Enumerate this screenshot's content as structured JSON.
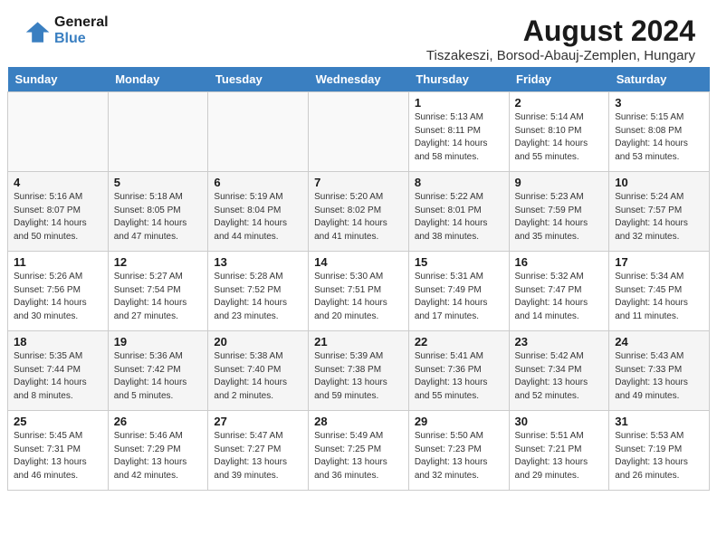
{
  "header": {
    "logo_line1": "General",
    "logo_line2": "Blue",
    "main_title": "August 2024",
    "subtitle": "Tiszakeszi, Borsod-Abauj-Zemplen, Hungary"
  },
  "days_of_week": [
    "Sunday",
    "Monday",
    "Tuesday",
    "Wednesday",
    "Thursday",
    "Friday",
    "Saturday"
  ],
  "weeks": [
    {
      "days": [
        {
          "num": "",
          "info": "",
          "empty": true
        },
        {
          "num": "",
          "info": "",
          "empty": true
        },
        {
          "num": "",
          "info": "",
          "empty": true
        },
        {
          "num": "",
          "info": "",
          "empty": true
        },
        {
          "num": "1",
          "info": "Sunrise: 5:13 AM\nSunset: 8:11 PM\nDaylight: 14 hours\nand 58 minutes.",
          "empty": false
        },
        {
          "num": "2",
          "info": "Sunrise: 5:14 AM\nSunset: 8:10 PM\nDaylight: 14 hours\nand 55 minutes.",
          "empty": false
        },
        {
          "num": "3",
          "info": "Sunrise: 5:15 AM\nSunset: 8:08 PM\nDaylight: 14 hours\nand 53 minutes.",
          "empty": false
        }
      ]
    },
    {
      "days": [
        {
          "num": "4",
          "info": "Sunrise: 5:16 AM\nSunset: 8:07 PM\nDaylight: 14 hours\nand 50 minutes.",
          "empty": false
        },
        {
          "num": "5",
          "info": "Sunrise: 5:18 AM\nSunset: 8:05 PM\nDaylight: 14 hours\nand 47 minutes.",
          "empty": false
        },
        {
          "num": "6",
          "info": "Sunrise: 5:19 AM\nSunset: 8:04 PM\nDaylight: 14 hours\nand 44 minutes.",
          "empty": false
        },
        {
          "num": "7",
          "info": "Sunrise: 5:20 AM\nSunset: 8:02 PM\nDaylight: 14 hours\nand 41 minutes.",
          "empty": false
        },
        {
          "num": "8",
          "info": "Sunrise: 5:22 AM\nSunset: 8:01 PM\nDaylight: 14 hours\nand 38 minutes.",
          "empty": false
        },
        {
          "num": "9",
          "info": "Sunrise: 5:23 AM\nSunset: 7:59 PM\nDaylight: 14 hours\nand 35 minutes.",
          "empty": false
        },
        {
          "num": "10",
          "info": "Sunrise: 5:24 AM\nSunset: 7:57 PM\nDaylight: 14 hours\nand 32 minutes.",
          "empty": false
        }
      ]
    },
    {
      "days": [
        {
          "num": "11",
          "info": "Sunrise: 5:26 AM\nSunset: 7:56 PM\nDaylight: 14 hours\nand 30 minutes.",
          "empty": false
        },
        {
          "num": "12",
          "info": "Sunrise: 5:27 AM\nSunset: 7:54 PM\nDaylight: 14 hours\nand 27 minutes.",
          "empty": false
        },
        {
          "num": "13",
          "info": "Sunrise: 5:28 AM\nSunset: 7:52 PM\nDaylight: 14 hours\nand 23 minutes.",
          "empty": false
        },
        {
          "num": "14",
          "info": "Sunrise: 5:30 AM\nSunset: 7:51 PM\nDaylight: 14 hours\nand 20 minutes.",
          "empty": false
        },
        {
          "num": "15",
          "info": "Sunrise: 5:31 AM\nSunset: 7:49 PM\nDaylight: 14 hours\nand 17 minutes.",
          "empty": false
        },
        {
          "num": "16",
          "info": "Sunrise: 5:32 AM\nSunset: 7:47 PM\nDaylight: 14 hours\nand 14 minutes.",
          "empty": false
        },
        {
          "num": "17",
          "info": "Sunrise: 5:34 AM\nSunset: 7:45 PM\nDaylight: 14 hours\nand 11 minutes.",
          "empty": false
        }
      ]
    },
    {
      "days": [
        {
          "num": "18",
          "info": "Sunrise: 5:35 AM\nSunset: 7:44 PM\nDaylight: 14 hours\nand 8 minutes.",
          "empty": false
        },
        {
          "num": "19",
          "info": "Sunrise: 5:36 AM\nSunset: 7:42 PM\nDaylight: 14 hours\nand 5 minutes.",
          "empty": false
        },
        {
          "num": "20",
          "info": "Sunrise: 5:38 AM\nSunset: 7:40 PM\nDaylight: 14 hours\nand 2 minutes.",
          "empty": false
        },
        {
          "num": "21",
          "info": "Sunrise: 5:39 AM\nSunset: 7:38 PM\nDaylight: 13 hours\nand 59 minutes.",
          "empty": false
        },
        {
          "num": "22",
          "info": "Sunrise: 5:41 AM\nSunset: 7:36 PM\nDaylight: 13 hours\nand 55 minutes.",
          "empty": false
        },
        {
          "num": "23",
          "info": "Sunrise: 5:42 AM\nSunset: 7:34 PM\nDaylight: 13 hours\nand 52 minutes.",
          "empty": false
        },
        {
          "num": "24",
          "info": "Sunrise: 5:43 AM\nSunset: 7:33 PM\nDaylight: 13 hours\nand 49 minutes.",
          "empty": false
        }
      ]
    },
    {
      "days": [
        {
          "num": "25",
          "info": "Sunrise: 5:45 AM\nSunset: 7:31 PM\nDaylight: 13 hours\nand 46 minutes.",
          "empty": false
        },
        {
          "num": "26",
          "info": "Sunrise: 5:46 AM\nSunset: 7:29 PM\nDaylight: 13 hours\nand 42 minutes.",
          "empty": false
        },
        {
          "num": "27",
          "info": "Sunrise: 5:47 AM\nSunset: 7:27 PM\nDaylight: 13 hours\nand 39 minutes.",
          "empty": false
        },
        {
          "num": "28",
          "info": "Sunrise: 5:49 AM\nSunset: 7:25 PM\nDaylight: 13 hours\nand 36 minutes.",
          "empty": false
        },
        {
          "num": "29",
          "info": "Sunrise: 5:50 AM\nSunset: 7:23 PM\nDaylight: 13 hours\nand 32 minutes.",
          "empty": false
        },
        {
          "num": "30",
          "info": "Sunrise: 5:51 AM\nSunset: 7:21 PM\nDaylight: 13 hours\nand 29 minutes.",
          "empty": false
        },
        {
          "num": "31",
          "info": "Sunrise: 5:53 AM\nSunset: 7:19 PM\nDaylight: 13 hours\nand 26 minutes.",
          "empty": false
        }
      ]
    }
  ]
}
